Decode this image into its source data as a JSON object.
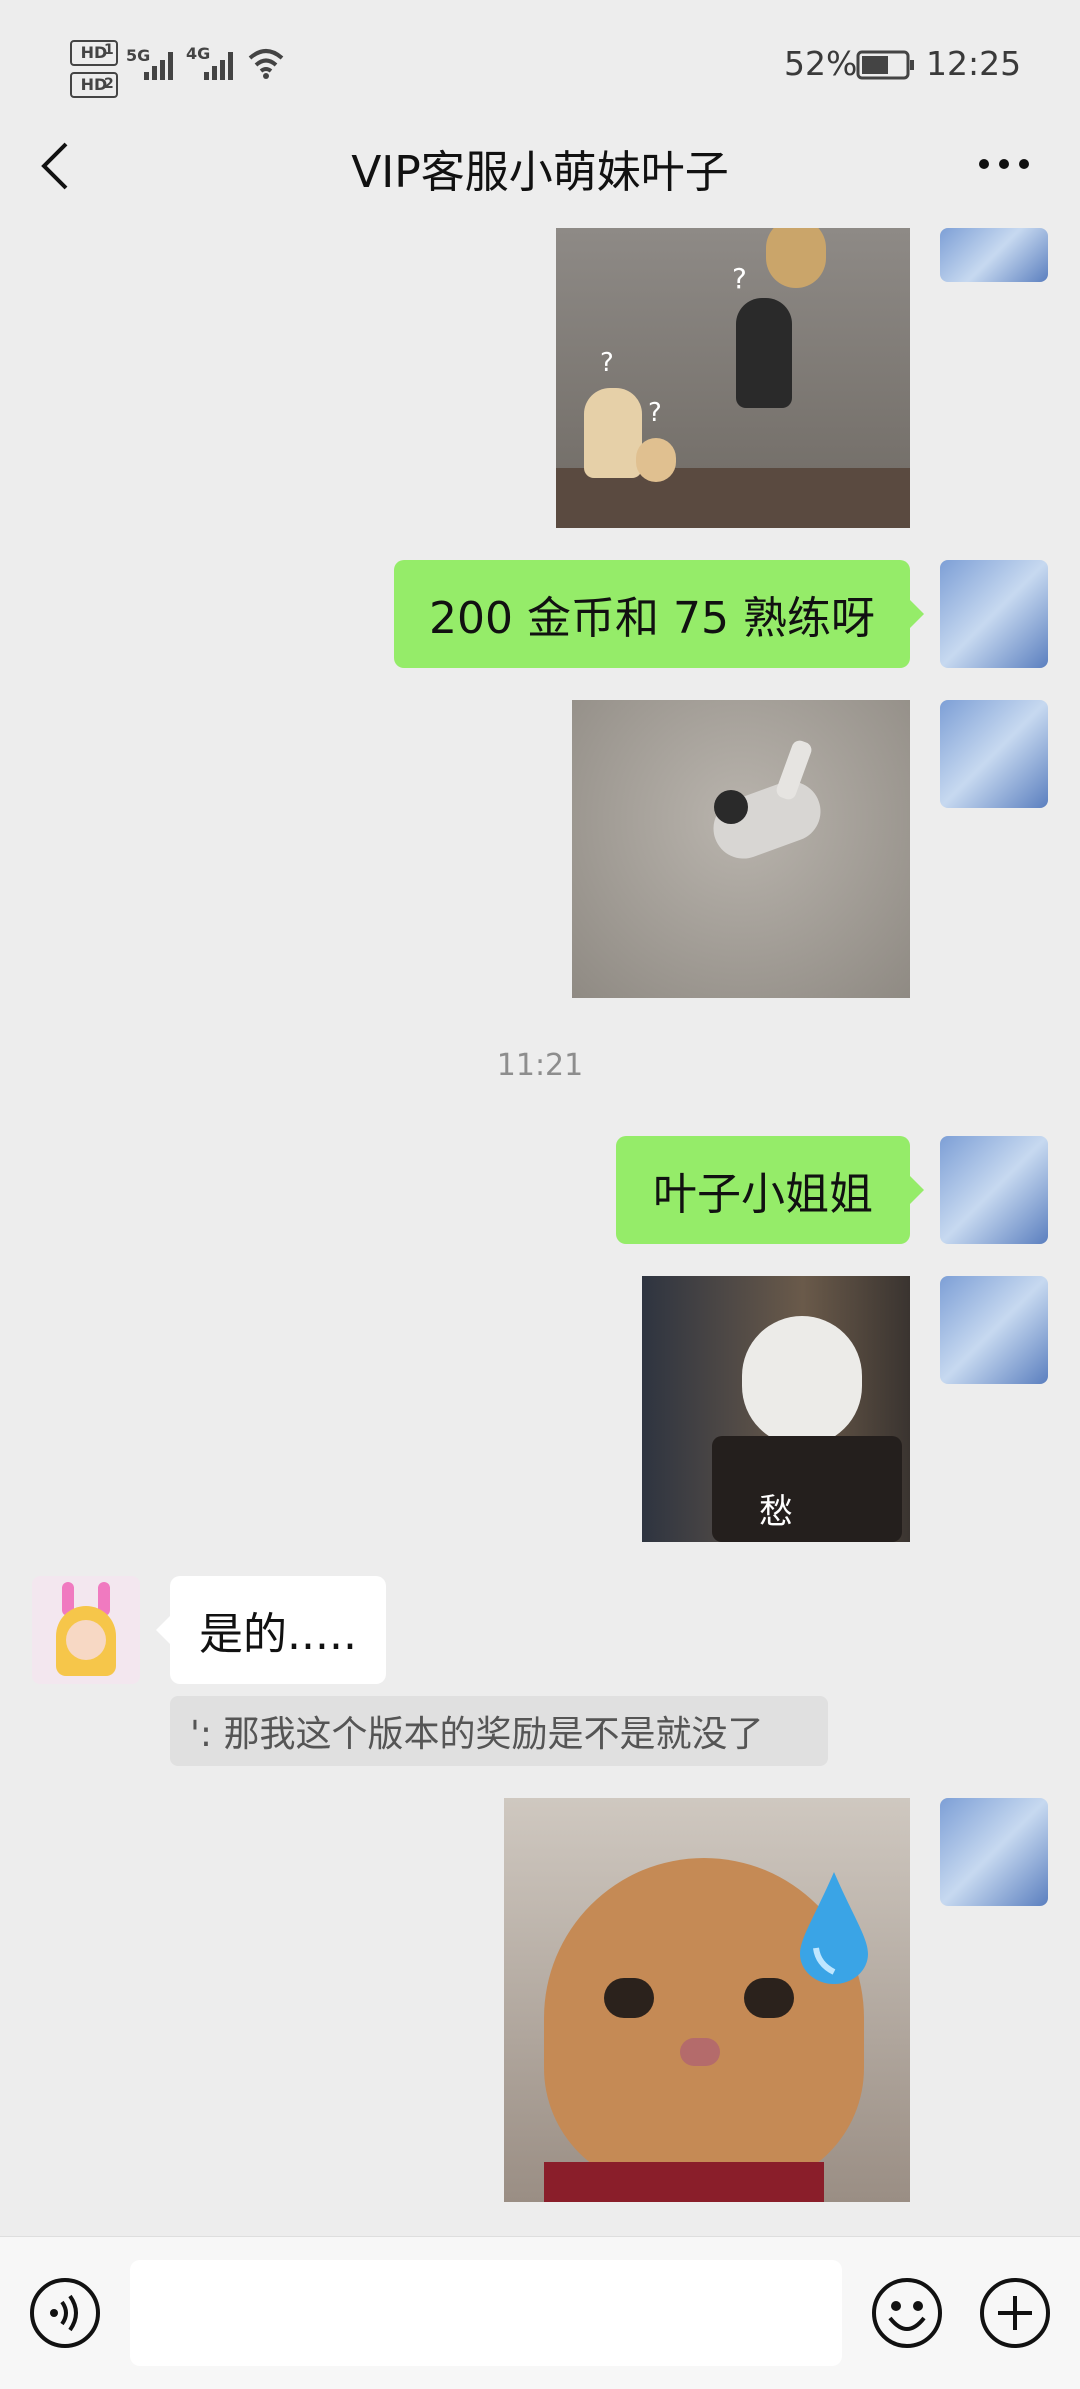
{
  "status_bar": {
    "hd1": "HD",
    "hd1_sub": "1",
    "hd2": "HD",
    "hd2_sub": "2",
    "net1": "5G",
    "net2": "4G",
    "battery": "52%",
    "time": "12:25"
  },
  "header": {
    "title": "VIP客服小萌妹叶子",
    "back_icon": "back-chevron-icon",
    "more_icon": "more-dots-icon"
  },
  "messages": {
    "msg_coins": "200 金币和 75 熟练呀",
    "timestamp": "11:21",
    "msg_sister": "叶子小姐姐",
    "sticker_cat_caption": "愁",
    "reply_yes": "是的.....",
    "quote_text": "': 那我这个版本的奖励是不是就没了"
  },
  "input_bar": {
    "voice_icon": "voice-icon",
    "emoji_icon": "emoji-icon",
    "plus_icon": "plus-icon",
    "text_value": ""
  },
  "colors": {
    "background": "#ededed",
    "my_bubble": "#95ec69",
    "other_bubble": "#ffffff"
  }
}
